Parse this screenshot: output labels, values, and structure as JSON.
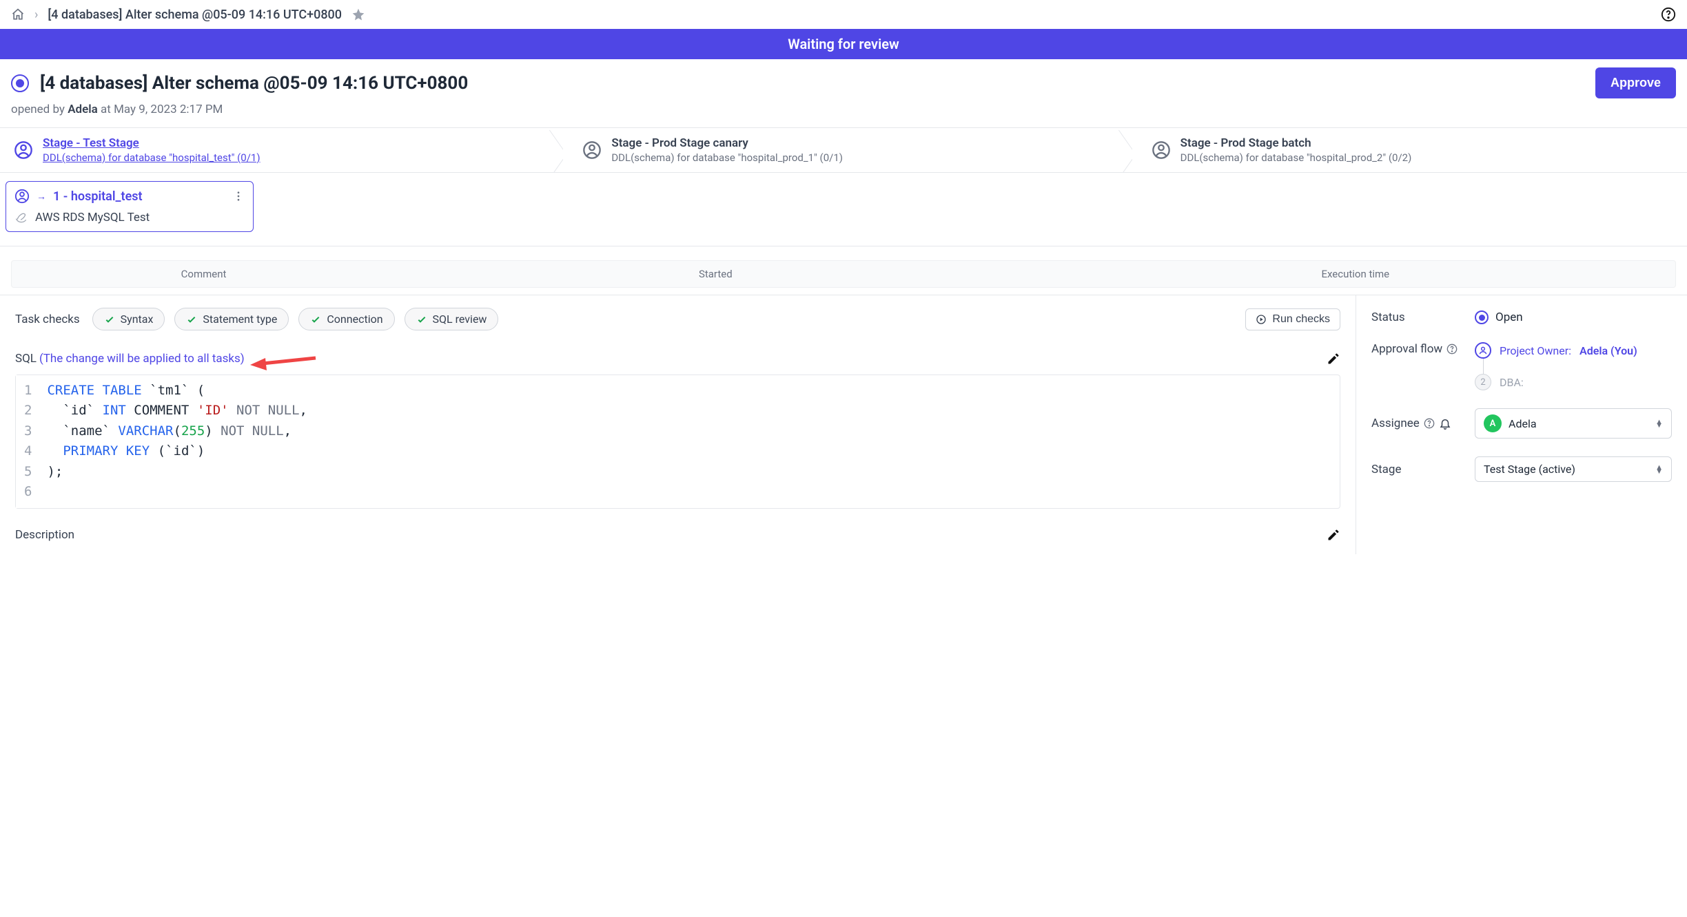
{
  "breadcrumb": {
    "title": "[4 databases] Alter schema @05-09 14:16 UTC+0800"
  },
  "banner": "Waiting for review",
  "header": {
    "title": "[4 databases] Alter schema @05-09 14:16 UTC+0800",
    "approve_label": "Approve",
    "opened_prefix": "opened by ",
    "opened_by": "Adela",
    "opened_mid": " at ",
    "opened_at": "May 9, 2023 2:17 PM"
  },
  "stages": [
    {
      "title": "Stage - Test Stage",
      "sub": "DDL(schema) for database \"hospital_test\" (0/1)",
      "active": true
    },
    {
      "title": "Stage - Prod Stage canary",
      "sub": "DDL(schema) for database \"hospital_prod_1\" (0/1)",
      "active": false
    },
    {
      "title": "Stage - Prod Stage batch",
      "sub": "DDL(schema) for database \"hospital_prod_2\" (0/2)",
      "active": false
    }
  ],
  "task_card": {
    "name": "1 - hospital_test",
    "instance": "AWS RDS MySQL Test"
  },
  "log_columns": {
    "c1": "Comment",
    "c2": "Started",
    "c3": "Execution time"
  },
  "checks": {
    "label": "Task checks",
    "items": [
      "Syntax",
      "Statement type",
      "Connection",
      "SQL review"
    ],
    "run_label": "Run checks"
  },
  "sql_section": {
    "label": "SQL",
    "note": "(The change will be applied to all tasks)"
  },
  "code": {
    "line_numbers": [
      "1",
      "2",
      "3",
      "4",
      "5",
      "6"
    ],
    "l1": {
      "a": "CREATE TABLE",
      "b": " `tm1` ("
    },
    "l2": {
      "a": "  `id` ",
      "b": "INT",
      "c": " COMMENT ",
      "d": "'ID'",
      "e": " NOT NULL",
      "f": ","
    },
    "l3": {
      "a": "  `name` ",
      "b": "VARCHAR",
      "c": "(",
      "d": "255",
      "e": ")",
      "f": " NOT NULL",
      "g": ","
    },
    "l4": {
      "a": "  ",
      "b": "PRIMARY KEY",
      "c": " (`id`)"
    },
    "l5": {
      "a": ");"
    }
  },
  "description_label": "Description",
  "sidebar": {
    "status_label": "Status",
    "status_value": "Open",
    "approval_label": "Approval flow",
    "flow_step1_role": "Project Owner:",
    "flow_step1_name": "Adela (You)",
    "flow_step2_num": "2",
    "flow_step2_role": "DBA:",
    "assignee_label": "Assignee",
    "assignee_initial": "A",
    "assignee_value": "Adela",
    "stage_label": "Stage",
    "stage_value": "Test Stage (active)"
  }
}
